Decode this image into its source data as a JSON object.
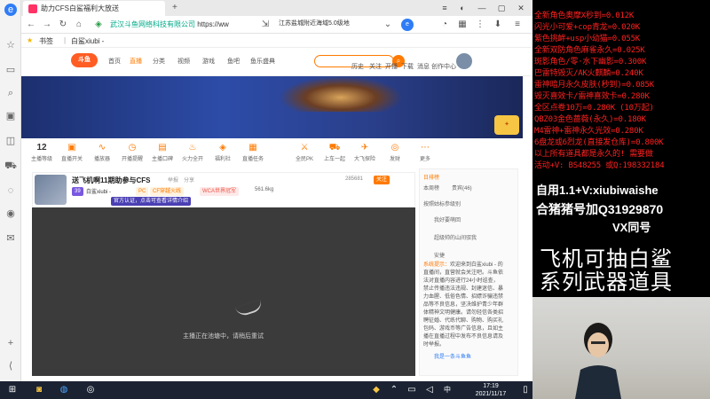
{
  "browser": {
    "tab_title": "助力CFS白鲨福利大放送",
    "address_company": "武汉斗鱼网络科技有限公司",
    "address_url": "https://ww",
    "ad_text": "江苏盐城附近海域5.0级地",
    "bookmarks_label": "书签",
    "bookmark_item": "白鲨xiubi -"
  },
  "site_nav": {
    "logo": "斗鱼",
    "links": [
      "首页",
      "直播",
      "分类",
      "视频",
      "游戏",
      "鱼吧",
      "鱼乐盛典"
    ],
    "right_links": [
      "历史",
      "关注",
      "开播",
      "下载",
      "消息",
      "创作中心"
    ]
  },
  "tools": [
    {
      "label": "12",
      "sub": "主播等级"
    },
    {
      "label": "直播开关",
      "sub": ""
    },
    {
      "label": "播放器",
      "sub": ""
    },
    {
      "label": "开播提醒",
      "sub": ""
    },
    {
      "label": "主播口碑",
      "sub": ""
    },
    {
      "label": "火力全开",
      "sub": ""
    },
    {
      "label": "福利社",
      "sub": ""
    },
    {
      "label": "直播任务",
      "sub": ""
    },
    {
      "label": "全民PK",
      "sub": ""
    },
    {
      "label": "上车一起",
      "sub": ""
    },
    {
      "label": "大飞探险",
      "sub": ""
    },
    {
      "label": "发财",
      "sub": ""
    },
    {
      "label": "更多",
      "sub": ""
    }
  ],
  "room": {
    "title": "送飞机啊11期助参与CFS",
    "report": "举报",
    "share": "分享",
    "anchor": "白鲨xiubi -",
    "level": "39",
    "tag_pc": "PC",
    "tag_cf": "CF穿越火线",
    "tag_wca": "WCA世界冠军",
    "heat": "561.6kg",
    "fans": "285681",
    "follow": "关注",
    "badge_official": "官方认证，点击可查看详情介绍",
    "offline_msg": "主播正在池塘中，请稍后重试"
  },
  "chat": {
    "tabs": [
      "日排榜",
      "本周榜",
      "贵宾(46)"
    ],
    "rows": [
      "按照姑标参级别",
      "我好要萌回",
      "超级帅的山间驭我",
      "安捷"
    ],
    "system_label": "系统提示：",
    "system_msg": "欢迎来到白鲨xiubi - 的直播间，直营就会关注吧。斗鱼依法对直播内容进行24小时巡查，禁止传播违法违规、封建迷信、暴力血腥、低俗色情、招嫖诈骗违禁品等不良信息，坚决维护青少年群体精神文明健康。请勿轻信各类招聘征婚、代练代聊、购物、购买礼包码、游戏币等广告信息，且如主播在直播过程中发布不良信息请及时举报。",
    "bottom_row": "我是一条斗鱼鱼"
  },
  "overlay": {
    "lines": [
      "全新角色奥摩X秒到=0.012K",
      "闪光小可爱+cop青龙=0.020K",
      "紫色挑衅+usp小幼猫=0.055K",
      "全新双防角色麻雀永久=0.025K",
      "斑影角色/零·水下幽影=0.300K",
      "巴雷特毁灭/AK火麒麟=0.240K",
      "雷神暗月永久皮肤(秒到)=0.085K",
      "毁灭喜效卡/雷神喜效卡=0.280K",
      "全区点卷10万=0.280K (10万起)",
      "QBZ03金色蔷薇(永久)=0.180K",
      "M4雷神+雷神永久光效=0.280K",
      "6盘龙或6烈龙(直接发仓库)=0.800K",
      "以上所有道具都是永久的! 需要做",
      "活动+V: BS48255  或Q:198332184"
    ],
    "self_use": "自用1.1+V:xiubiwaishe",
    "qq": "合猪猪号加Q31929870",
    "vx": "VX同号",
    "slogan1": "飞机可抽白鲨",
    "slogan2": "系列武器道具"
  },
  "taskbar": {
    "time": "17:19",
    "date": "2021/11/17",
    "ime": "中"
  },
  "colors": {
    "accent": "#ff7a00",
    "overlay_text": "#ff2020",
    "banner": "#2d4ca8"
  }
}
